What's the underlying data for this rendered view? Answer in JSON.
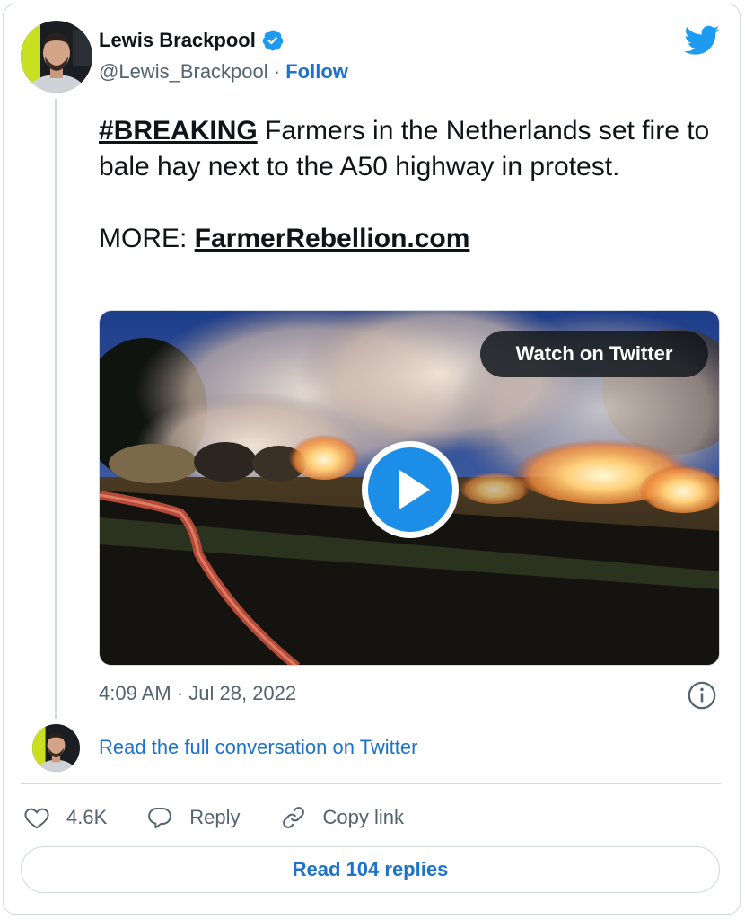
{
  "author": {
    "display_name": "Lewis Brackpool",
    "handle": "@Lewis_Brackpool",
    "separator": "·",
    "follow_label": "Follow",
    "avatar_icon": "avatar-photo",
    "verified_icon": "verified-badge-icon"
  },
  "brand_icon": "twitter-bird-icon",
  "tweet": {
    "hashtag": "#BREAKING",
    "text": " Farmers in the Netherlands set fire to bale hay next to the A50 highway in protest.",
    "more_prefix": "MORE: ",
    "link": "FarmerRebellion.com"
  },
  "media": {
    "watch_label": "Watch on Twitter",
    "play_icon": "play-icon"
  },
  "meta": {
    "timestamp": "4:09 AM · Jul 28, 2022",
    "info_icon": "info-icon"
  },
  "conversation": {
    "read_full_label": "Read the full conversation on Twitter"
  },
  "actions": {
    "likes_count": "4.6K",
    "reply_label": "Reply",
    "copy_link_label": "Copy link"
  },
  "footer": {
    "read_replies_label": "Read 104 replies"
  },
  "colors": {
    "link_blue": "#1d73c9",
    "twitter_blue": "#1d9bf0",
    "secondary_text": "#536471",
    "border": "#cfd9de"
  }
}
